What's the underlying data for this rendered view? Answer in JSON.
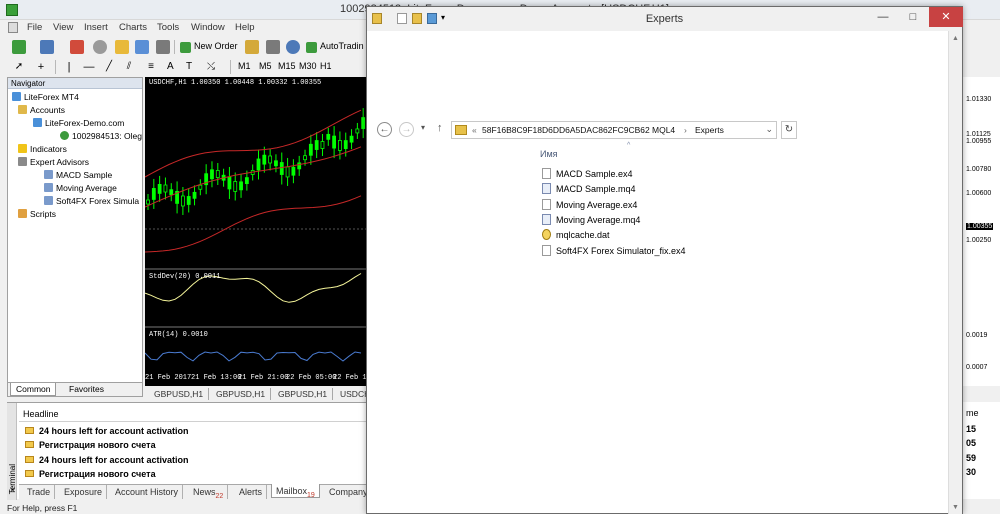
{
  "mt4": {
    "title": "1002984513: LiteForex-Demo.com - Demo Account - [USDCHF,H1]",
    "menu": [
      "File",
      "View",
      "Insert",
      "Charts",
      "Tools",
      "Window",
      "Help"
    ],
    "toolbar": {
      "new_order": "New Order",
      "autotrading": "AutoTradin"
    },
    "timeframes": [
      "M1",
      "M5",
      "M15",
      "M30",
      "H1"
    ],
    "letter_tools": [
      "A",
      "T"
    ]
  },
  "navigator": {
    "title": "Navigator",
    "tree": {
      "root": "LiteForex MT4",
      "accounts": "Accounts",
      "server": "LiteForex-Demo.com",
      "account": "1002984513: Oleg",
      "indicators": "Indicators",
      "expert_advisors": "Expert Advisors",
      "experts": [
        "MACD Sample",
        "Moving Average",
        "Soft4FX Forex Simula"
      ],
      "scripts": "Scripts"
    },
    "tabs": [
      "Common",
      "Favorites"
    ]
  },
  "chart": {
    "header": "USDCHF,H1  1.00350 1.00448 1.00332 1.00355",
    "stddev_label": "StdDev(20) 0.0011",
    "atr_label": "ATR(14) 0.0010",
    "dates": [
      "21 Feb 2017",
      "21 Feb 13:00",
      "21 Feb 21:00",
      "22 Feb 05:00",
      "22 Feb 13:"
    ],
    "tabs": [
      "GBPUSD,H1",
      "GBPUSD,H1",
      "GBPUSD,H1",
      "USDCH"
    ],
    "price_axis": [
      "1.01330",
      "1.01125",
      "1.00955",
      "1.00780",
      "1.00600",
      "1.00355",
      "1.00250",
      "0.0019",
      "0.0007"
    ],
    "colors": {
      "candle": "#00ff00",
      "band": "#c62828",
      "stddev": "#f5f59a",
      "atr": "#4a7bd1"
    }
  },
  "terminal": {
    "side_label": "Terminal",
    "header": "Headline",
    "rows": [
      "24 hours left for account activation",
      "Регистрация нового счета",
      "24 hours left for account activation",
      "Регистрация нового счета"
    ],
    "tabs": [
      {
        "label": "Trade"
      },
      {
        "label": "Exposure"
      },
      {
        "label": "Account History"
      },
      {
        "label": "News",
        "count": "22"
      },
      {
        "label": "Alerts"
      },
      {
        "label": "Mailbox",
        "count": "19"
      },
      {
        "label": "Company"
      }
    ],
    "right_col": {
      "header": "me",
      "values": [
        "15",
        "05",
        "59",
        "30"
      ]
    }
  },
  "status": "For Help, press F1",
  "explorer": {
    "title": "Experts",
    "address": [
      "58F16B8C9F18D6DD6A5DAC862FC9CB62",
      "MQL4",
      "Experts"
    ],
    "column": "Имя",
    "files": [
      {
        "name": "MACD Sample.ex4",
        "type": "ex4"
      },
      {
        "name": "MACD Sample.mq4",
        "type": "mq4"
      },
      {
        "name": "Moving Average.ex4",
        "type": "ex4"
      },
      {
        "name": "Moving Average.mq4",
        "type": "mq4"
      },
      {
        "name": "mqlcache.dat",
        "type": "dat"
      },
      {
        "name": "Soft4FX Forex Simulator_fix.ex4",
        "type": "ex4"
      }
    ]
  }
}
